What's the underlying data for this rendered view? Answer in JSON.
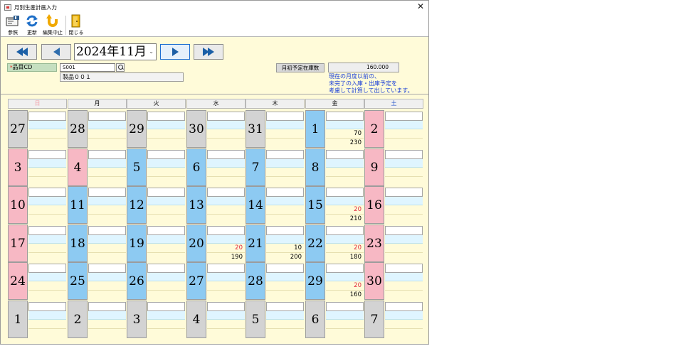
{
  "window": {
    "title": "月別生産計画入力",
    "close_label": "✕"
  },
  "toolbar": {
    "buttons": [
      {
        "label": "参照",
        "icon": "reference-book-icon"
      },
      {
        "label": "更新",
        "icon": "refresh-arrows-icon"
      },
      {
        "label": "編集中止",
        "icon": "undo-arrow-icon"
      },
      {
        "label": "閉じる",
        "icon": "door-exit-icon"
      }
    ]
  },
  "header": {
    "month_value": "2024年11月",
    "item_label": "品目CD",
    "item_required_mark": "*",
    "item_code": "S001",
    "item_name": "製品００１",
    "stock_label": "月初予定在庫数",
    "stock_value": "160.000",
    "note": "現在の月度以前の、\n未完了の入庫・出庫予定を\n考慮して計算して出しています。"
  },
  "colors": {
    "blue_day": "#8dcaf2",
    "pink_day": "#f7b8c4",
    "grey_day": "#d3d3d3",
    "panel": "#fffbd9",
    "red_value": "#e0283c"
  },
  "calendar": {
    "weekdays": [
      "日",
      "月",
      "火",
      "水",
      "木",
      "金",
      "土"
    ],
    "weeks": [
      [
        {
          "day": "27",
          "type": "g",
          "r3": "",
          "r4": ""
        },
        {
          "day": "28",
          "type": "g",
          "r3": "",
          "r4": ""
        },
        {
          "day": "29",
          "type": "g",
          "r3": "",
          "r4": ""
        },
        {
          "day": "30",
          "type": "g",
          "r3": "",
          "r4": ""
        },
        {
          "day": "31",
          "type": "g",
          "r3": "",
          "r4": ""
        },
        {
          "day": "1",
          "type": "b",
          "r3": "70",
          "r4": "230"
        },
        {
          "day": "2",
          "type": "p",
          "r3": "",
          "r4": ""
        }
      ],
      [
        {
          "day": "3",
          "type": "p",
          "r3": "",
          "r4": ""
        },
        {
          "day": "4",
          "type": "p",
          "r3": "",
          "r4": ""
        },
        {
          "day": "5",
          "type": "b",
          "r3": "",
          "r4": ""
        },
        {
          "day": "6",
          "type": "b",
          "r3": "",
          "r4": ""
        },
        {
          "day": "7",
          "type": "b",
          "r3": "",
          "r4": ""
        },
        {
          "day": "8",
          "type": "b",
          "r3": "",
          "r4": ""
        },
        {
          "day": "9",
          "type": "p",
          "r3": "",
          "r4": ""
        }
      ],
      [
        {
          "day": "10",
          "type": "p",
          "r3": "",
          "r4": ""
        },
        {
          "day": "11",
          "type": "b",
          "r3": "",
          "r4": ""
        },
        {
          "day": "12",
          "type": "b",
          "r3": "",
          "r4": ""
        },
        {
          "day": "13",
          "type": "b",
          "r3": "",
          "r4": ""
        },
        {
          "day": "14",
          "type": "b",
          "r3": "",
          "r4": ""
        },
        {
          "day": "15",
          "type": "b",
          "r3": "20",
          "r3red": true,
          "r4": "210"
        },
        {
          "day": "16",
          "type": "p",
          "r3": "",
          "r4": ""
        }
      ],
      [
        {
          "day": "17",
          "type": "p",
          "r3": "",
          "r4": ""
        },
        {
          "day": "18",
          "type": "b",
          "r3": "",
          "r4": ""
        },
        {
          "day": "19",
          "type": "b",
          "r3": "",
          "r4": ""
        },
        {
          "day": "20",
          "type": "b",
          "r3": "20",
          "r3red": true,
          "r4": "190"
        },
        {
          "day": "21",
          "type": "b",
          "r3": "10",
          "r4": "200"
        },
        {
          "day": "22",
          "type": "b",
          "r3": "20",
          "r3red": true,
          "r4": "180"
        },
        {
          "day": "23",
          "type": "p",
          "r3": "",
          "r4": ""
        }
      ],
      [
        {
          "day": "24",
          "type": "p",
          "r3": "",
          "r4": ""
        },
        {
          "day": "25",
          "type": "b",
          "r3": "",
          "r4": ""
        },
        {
          "day": "26",
          "type": "b",
          "r3": "",
          "r4": ""
        },
        {
          "day": "27",
          "type": "b",
          "r3": "",
          "r4": ""
        },
        {
          "day": "28",
          "type": "b",
          "r3": "",
          "r4": ""
        },
        {
          "day": "29",
          "type": "b",
          "r3": "20",
          "r3red": true,
          "r4": "160"
        },
        {
          "day": "30",
          "type": "p",
          "r3": "",
          "r4": ""
        }
      ],
      [
        {
          "day": "1",
          "type": "g",
          "r3": "",
          "r4": ""
        },
        {
          "day": "2",
          "type": "g",
          "r3": "",
          "r4": ""
        },
        {
          "day": "3",
          "type": "g",
          "r3": "",
          "r4": ""
        },
        {
          "day": "4",
          "type": "g",
          "r3": "",
          "r4": ""
        },
        {
          "day": "5",
          "type": "g",
          "r3": "",
          "r4": ""
        },
        {
          "day": "6",
          "type": "g",
          "r3": "",
          "r4": ""
        },
        {
          "day": "7",
          "type": "g",
          "r3": "",
          "r4": ""
        }
      ]
    ]
  }
}
